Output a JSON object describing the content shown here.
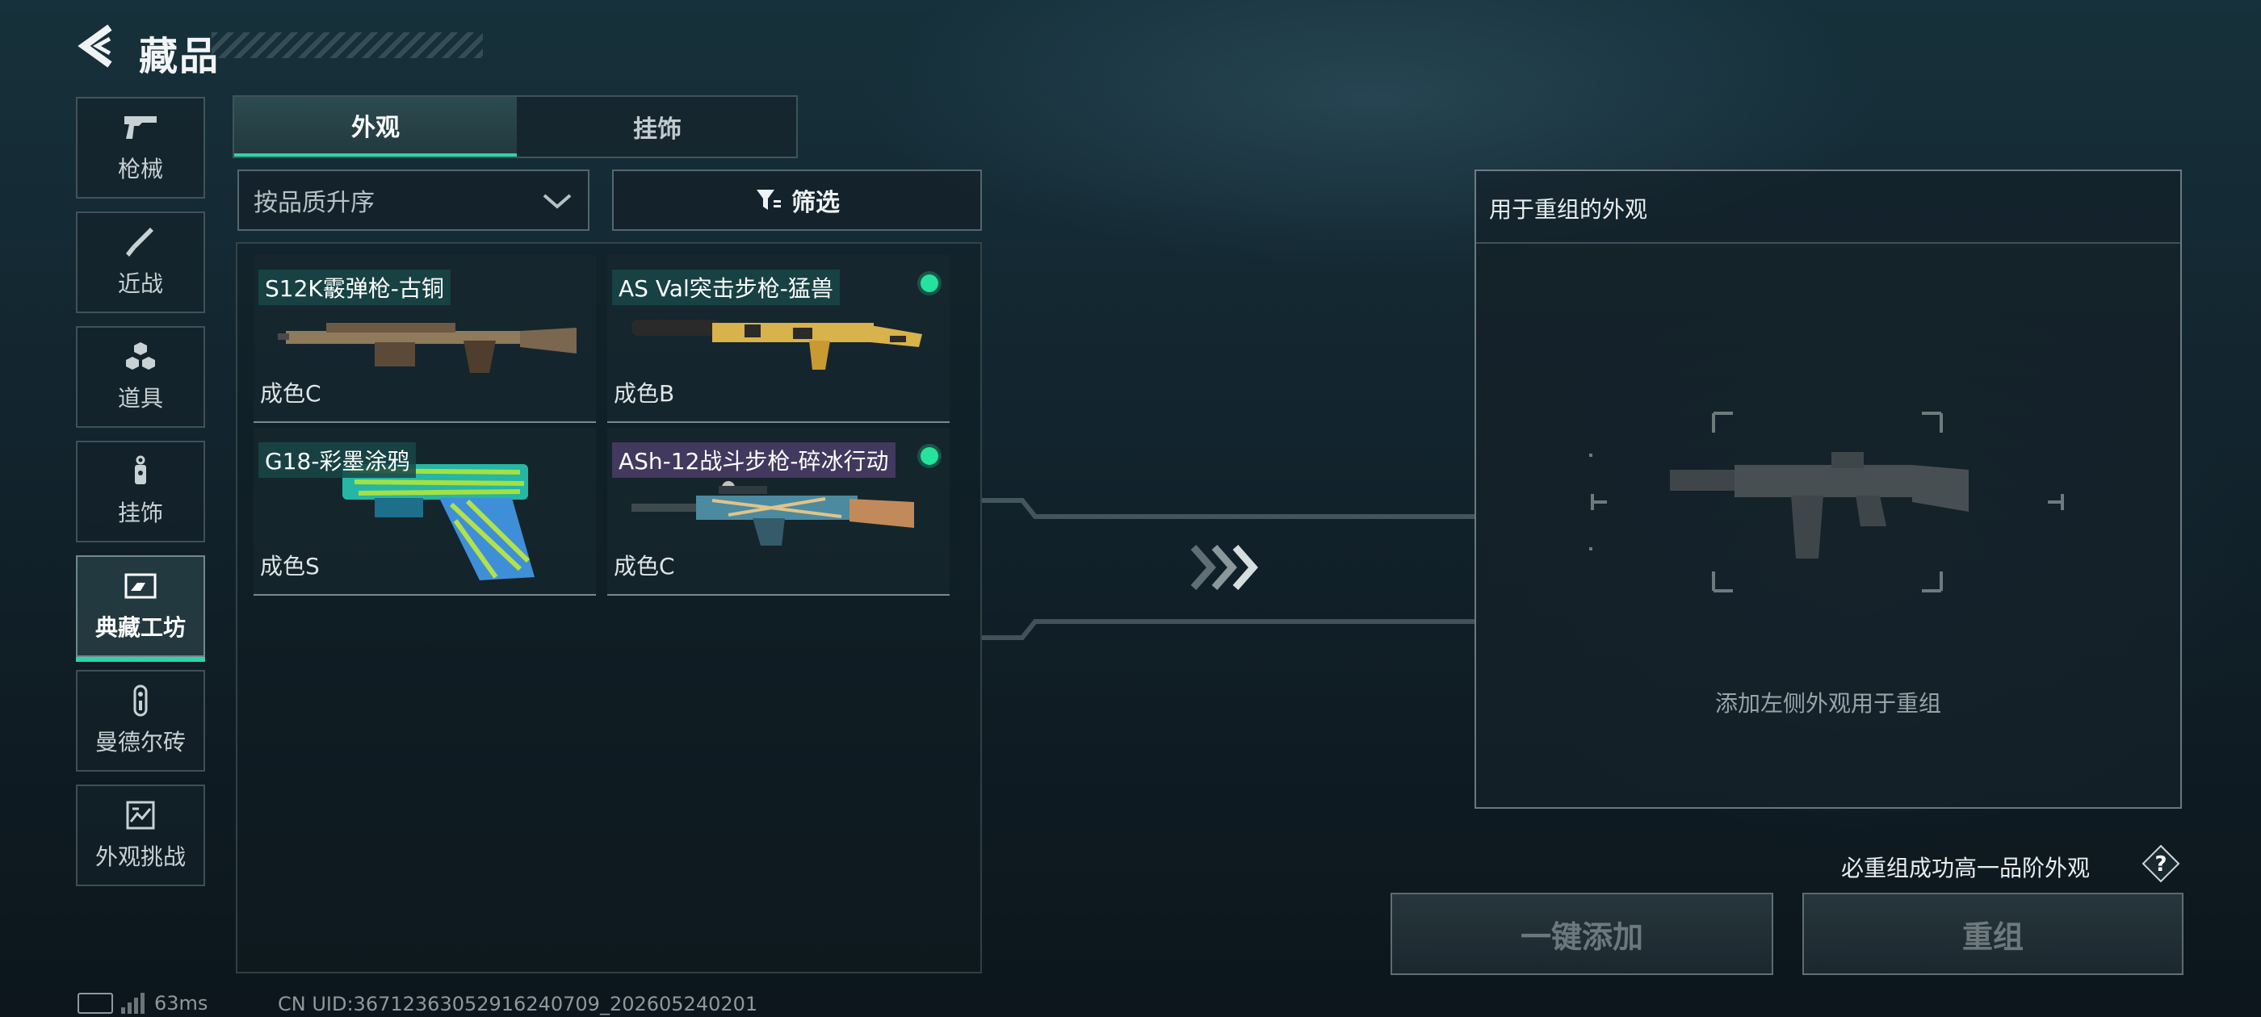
{
  "header": {
    "title": "藏品",
    "back_icon": "chevron-left-icon"
  },
  "sidebar": {
    "items": [
      {
        "label": "枪械",
        "icon": "pistol-icon",
        "active": false
      },
      {
        "label": "近战",
        "icon": "knife-icon",
        "active": false
      },
      {
        "label": "道具",
        "icon": "hexagon-cluster-icon",
        "active": false
      },
      {
        "label": "挂饰",
        "icon": "keychain-icon",
        "active": false
      },
      {
        "label": "典藏工坊",
        "icon": "workshop-card-icon",
        "active": true
      },
      {
        "label": "曼德尔砖",
        "icon": "mandel-brick-icon",
        "active": false
      },
      {
        "label": "外观挑战",
        "icon": "challenge-map-icon",
        "active": false
      }
    ]
  },
  "tabs": [
    {
      "label": "外观",
      "active": true
    },
    {
      "label": "挂饰",
      "active": false
    }
  ],
  "sort": {
    "value": "按品质升序"
  },
  "filter": {
    "label": "筛选"
  },
  "skins": [
    {
      "name": "S12K霰弹枪-古铜",
      "grade": "成色C",
      "new": false,
      "name_style": "green"
    },
    {
      "name": "AS Val突击步枪-猛兽",
      "grade": "成色B",
      "new": true,
      "name_style": "green"
    },
    {
      "name": "G18-彩墨涂鸦",
      "grade": "成色S",
      "new": false,
      "name_style": "green"
    },
    {
      "name": "ASh-12战斗步枪-碎冰行动",
      "grade": "成色C",
      "new": true,
      "name_style": "purple"
    }
  ],
  "recompose": {
    "title": "用于重组的外观",
    "hint": "添加左侧外观用于重组",
    "guarantee": "必重组成功高一品阶外观"
  },
  "buttons": {
    "add_all": "一键添加",
    "recompose": "重组"
  },
  "status": {
    "ping": "63ms",
    "uid": "CN UID:36712363052916240709_202605240201"
  },
  "colors": {
    "accent": "#2fd3a9",
    "new_dot": "#25e39c"
  }
}
